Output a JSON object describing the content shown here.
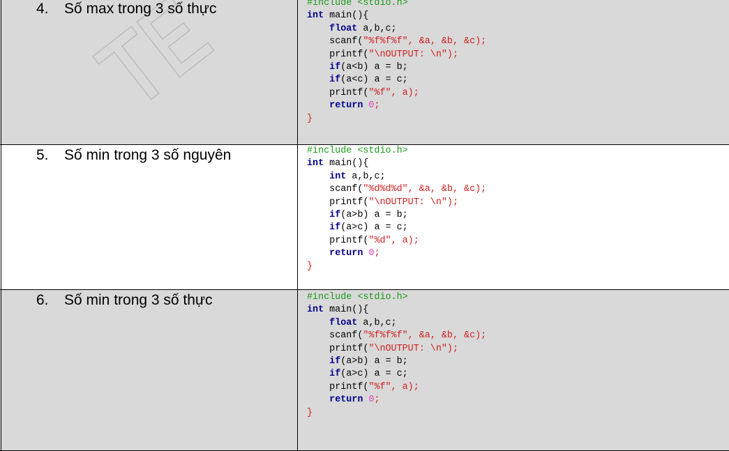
{
  "rows": [
    {
      "number": "4.",
      "title": "Số max trong 3 số thực",
      "code": {
        "include": "#include <stdio.h>",
        "main_kw": "int",
        "main_sig": " main(){",
        "decl_kw": "float",
        "decl_vars": " a,b,c;",
        "scanf_call": "scanf(",
        "scanf_fmt": "\"%f%f%f\"",
        "scanf_args": ", &a, &b, &c);",
        "printf1_call": "printf(",
        "printf1_str": "\"\\nOUTPUT: \\n\"",
        "printf1_end": ");",
        "if1_kw": "if",
        "if1_body": "(a<b) a = b;",
        "if2_kw": "if",
        "if2_body": "(a<c) a = c;",
        "printf2_call": "printf(",
        "printf2_str": "\"%f\"",
        "printf2_end": ", a);",
        "return_kw": "return",
        "return_val": " 0",
        "return_end": ";",
        "close": "}"
      }
    },
    {
      "number": "5.",
      "title": "Số min trong 3 số nguyên",
      "code": {
        "include": "#include <stdio.h>",
        "main_kw": "int",
        "main_sig": " main(){",
        "decl_kw": "int",
        "decl_vars": " a,b,c;",
        "scanf_call": "scanf(",
        "scanf_fmt": "\"%d%d%d\"",
        "scanf_args": ", &a, &b, &c);",
        "printf1_call": "printf(",
        "printf1_str": "\"\\nOUTPUT: \\n\"",
        "printf1_end": ");",
        "if1_kw": "if",
        "if1_body": "(a>b) a = b;",
        "if2_kw": "if",
        "if2_body": "(a>c) a = c;",
        "printf2_call": "printf(",
        "printf2_str": "\"%d\"",
        "printf2_end": ", a);",
        "return_kw": "return",
        "return_val": " 0",
        "return_end": ";",
        "close": "}"
      }
    },
    {
      "number": "6.",
      "title": "Số min trong 3 số thực",
      "code": {
        "include": "#include <stdio.h>",
        "main_kw": "int",
        "main_sig": " main(){",
        "decl_kw": "float",
        "decl_vars": " a,b,c;",
        "scanf_call": "scanf(",
        "scanf_fmt": "\"%f%f%f\"",
        "scanf_args": ", &a, &b, &c);",
        "printf1_call": "printf(",
        "printf1_str": "\"\\nOUTPUT: \\n\"",
        "printf1_end": ");",
        "if1_kw": "if",
        "if1_body": "(a>b) a = b;",
        "if2_kw": "if",
        "if2_body": "(a>c) a = c;",
        "printf2_call": "printf(",
        "printf2_str": "\"%f\"",
        "printf2_end": ", a);",
        "return_kw": "return",
        "return_val": " 0",
        "return_end": ";",
        "close": "}"
      }
    }
  ],
  "watermark": {
    "text": "TE",
    "color": "#c8c8c8"
  }
}
